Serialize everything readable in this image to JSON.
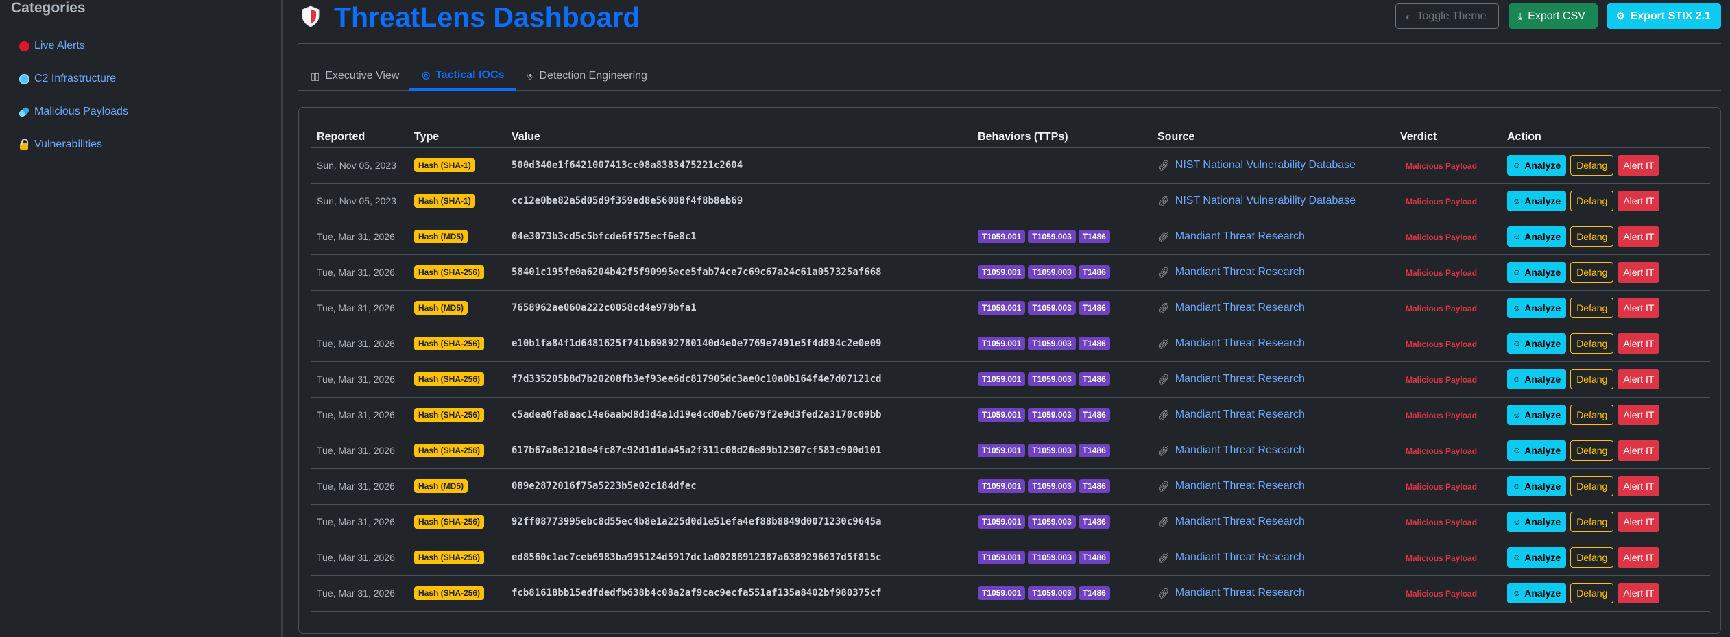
{
  "sidebar": {
    "title": "Categories",
    "items": [
      {
        "label": "Live Alerts",
        "icon": "red-circle-icon"
      },
      {
        "label": "C2 Infrastructure",
        "icon": "globe-icon"
      },
      {
        "label": "Malicious Payloads",
        "icon": "pill-icon"
      },
      {
        "label": "Vulnerabilities",
        "icon": "lock-icon"
      }
    ]
  },
  "header": {
    "title": "ThreatLens Dashboard",
    "toggle_theme_label": "Toggle Theme",
    "export_csv_label": "Export CSV",
    "export_stix_label": "Export STIX 2.1"
  },
  "tabs": [
    {
      "label": "Executive View",
      "icon": "bar-chart-icon"
    },
    {
      "label": "Tactical IOCs",
      "icon": "target-icon",
      "active": true
    },
    {
      "label": "Detection Engineering",
      "icon": "shield-icon"
    }
  ],
  "table": {
    "columns": [
      "Reported",
      "Type",
      "Value",
      "Behaviors (TTPs)",
      "Source",
      "Verdict",
      "Action"
    ],
    "action_labels": {
      "analyze": "Analyze",
      "defang": "Defang",
      "alert": "Alert IT"
    },
    "rows": [
      {
        "date": "Sun, Nov 05, 2023",
        "type": "Hash (SHA-1)",
        "value": "500d340e1f6421007413cc08a8383475221c2604",
        "ttps": [],
        "source": "NIST National Vulnerability Database",
        "verdict": "Malicious Payload"
      },
      {
        "date": "Sun, Nov 05, 2023",
        "type": "Hash (SHA-1)",
        "value": "cc12e0be82a5d05d9f359ed8e56088f4f8b8eb69",
        "ttps": [],
        "source": "NIST National Vulnerability Database",
        "verdict": "Malicious Payload"
      },
      {
        "date": "Tue, Mar 31, 2026",
        "type": "Hash (MD5)",
        "value": "04e3073b3cd5c5bfcde6f575ecf6e8c1",
        "ttps": [
          "T1059.001",
          "T1059.003",
          "T1486"
        ],
        "source": "Mandiant Threat Research",
        "verdict": "Malicious Payload"
      },
      {
        "date": "Tue, Mar 31, 2026",
        "type": "Hash (SHA-256)",
        "value": "58401c195fe0a6204b42f5f90995ece5fab74ce7c69c67a24c61a057325af668",
        "ttps": [
          "T1059.001",
          "T1059.003",
          "T1486"
        ],
        "source": "Mandiant Threat Research",
        "verdict": "Malicious Payload"
      },
      {
        "date": "Tue, Mar 31, 2026",
        "type": "Hash (MD5)",
        "value": "7658962ae060a222c0058cd4e979bfa1",
        "ttps": [
          "T1059.001",
          "T1059.003",
          "T1486"
        ],
        "source": "Mandiant Threat Research",
        "verdict": "Malicious Payload"
      },
      {
        "date": "Tue, Mar 31, 2026",
        "type": "Hash (SHA-256)",
        "value": "e10b1fa84f1d6481625f741b69892780140d4e0e7769e7491e5f4d894c2e0e09",
        "ttps": [
          "T1059.001",
          "T1059.003",
          "T1486"
        ],
        "source": "Mandiant Threat Research",
        "verdict": "Malicious Payload"
      },
      {
        "date": "Tue, Mar 31, 2026",
        "type": "Hash (SHA-256)",
        "value": "f7d335205b8d7b20208fb3ef93ee6dc817905dc3ae0c10a0b164f4e7d07121cd",
        "ttps": [
          "T1059.001",
          "T1059.003",
          "T1486"
        ],
        "source": "Mandiant Threat Research",
        "verdict": "Malicious Payload"
      },
      {
        "date": "Tue, Mar 31, 2026",
        "type": "Hash (SHA-256)",
        "value": "c5adea0fa8aac14e6aabd8d3d4a1d19e4cd0eb76e679f2e9d3fed2a3170c09bb",
        "ttps": [
          "T1059.001",
          "T1059.003",
          "T1486"
        ],
        "source": "Mandiant Threat Research",
        "verdict": "Malicious Payload"
      },
      {
        "date": "Tue, Mar 31, 2026",
        "type": "Hash (SHA-256)",
        "value": "617b67a8e1210e4fc87c92d1d1da45a2f311c08d26e89b12307cf583c900d101",
        "ttps": [
          "T1059.001",
          "T1059.003",
          "T1486"
        ],
        "source": "Mandiant Threat Research",
        "verdict": "Malicious Payload"
      },
      {
        "date": "Tue, Mar 31, 2026",
        "type": "Hash (MD5)",
        "value": "089e2872016f75a5223b5e02c184dfec",
        "ttps": [
          "T1059.001",
          "T1059.003",
          "T1486"
        ],
        "source": "Mandiant Threat Research",
        "verdict": "Malicious Payload"
      },
      {
        "date": "Tue, Mar 31, 2026",
        "type": "Hash (SHA-256)",
        "value": "92ff08773995ebc8d55ec4b8e1a225d0d1e51efa4ef88b8849d0071230c9645a",
        "ttps": [
          "T1059.001",
          "T1059.003",
          "T1486"
        ],
        "source": "Mandiant Threat Research",
        "verdict": "Malicious Payload"
      },
      {
        "date": "Tue, Mar 31, 2026",
        "type": "Hash (SHA-256)",
        "value": "ed8560c1ac7ceb6983ba995124d5917dc1a00288912387a6389296637d5f815c",
        "ttps": [
          "T1059.001",
          "T1059.003",
          "T1486"
        ],
        "source": "Mandiant Threat Research",
        "verdict": "Malicious Payload"
      },
      {
        "date": "Tue, Mar 31, 2026",
        "type": "Hash (SHA-256)",
        "value": "fcb81618bb15edfdedfb638b4c08a2af9cac9ecfa551af135a8402bf980375cf",
        "ttps": [
          "T1059.001",
          "T1059.003",
          "T1486"
        ],
        "source": "Mandiant Threat Research",
        "verdict": "Malicious Payload"
      }
    ]
  }
}
